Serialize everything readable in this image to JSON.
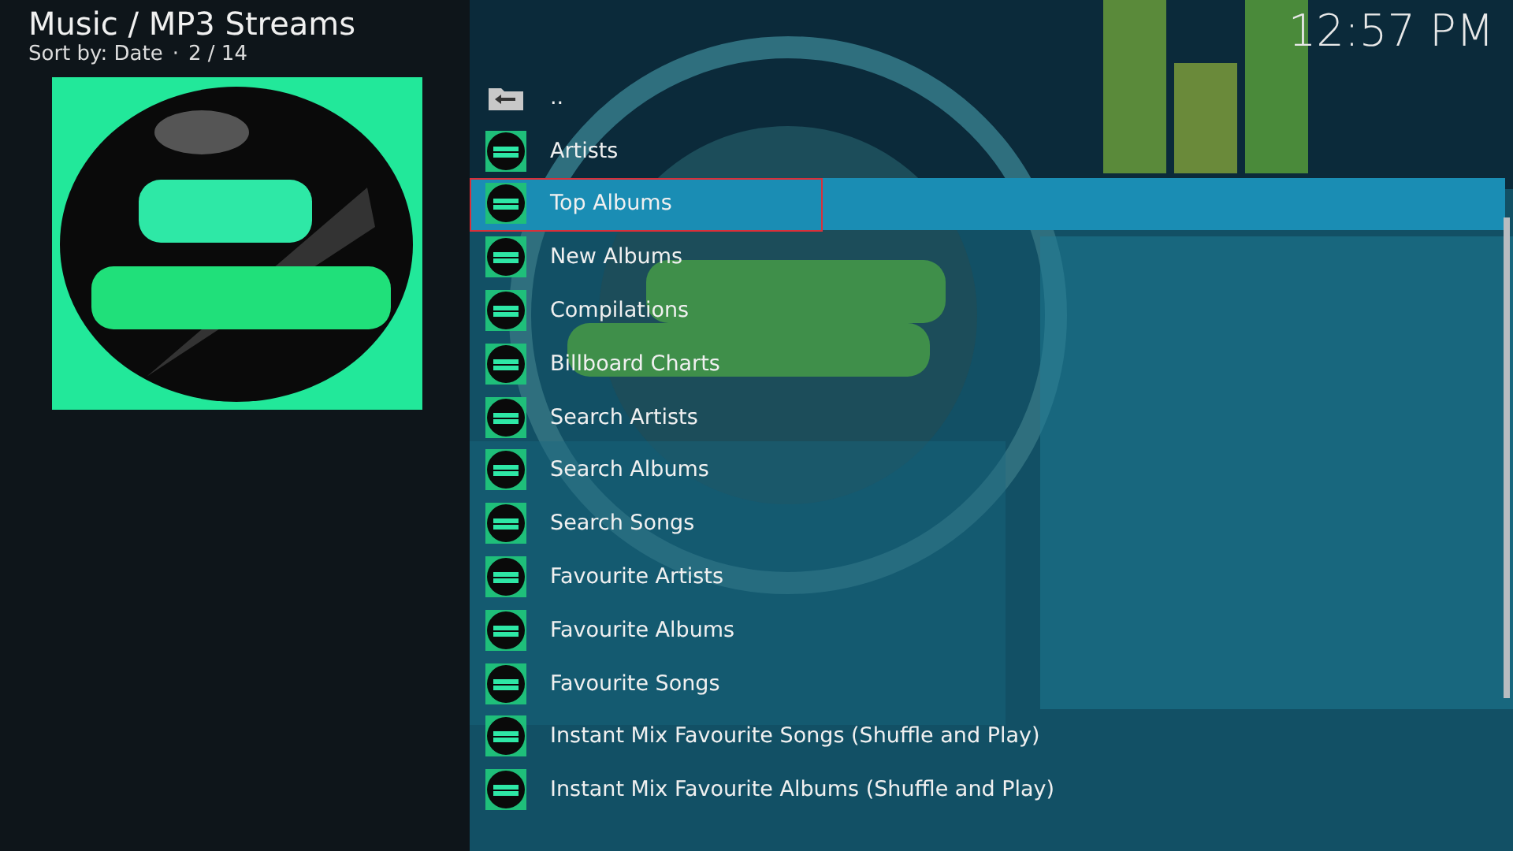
{
  "header": {
    "title": "Music / MP3 Streams",
    "sort": "Sort by: Date",
    "separator": "·",
    "position": "2 / 14"
  },
  "clock": "12:57 PM",
  "items": [
    {
      "label": "..",
      "kind": "parent",
      "selected": false
    },
    {
      "label": "Artists",
      "kind": "entry",
      "selected": false
    },
    {
      "label": "Top Albums",
      "kind": "entry",
      "selected": true
    },
    {
      "label": "New Albums",
      "kind": "entry",
      "selected": false
    },
    {
      "label": "Compilations",
      "kind": "entry",
      "selected": false
    },
    {
      "label": "Billboard Charts",
      "kind": "entry",
      "selected": false
    },
    {
      "label": "Search Artists",
      "kind": "entry",
      "selected": false
    },
    {
      "label": "Search Albums",
      "kind": "entry",
      "selected": false
    },
    {
      "label": "Search Songs",
      "kind": "entry",
      "selected": false
    },
    {
      "label": "Favourite Artists",
      "kind": "entry",
      "selected": false
    },
    {
      "label": "Favourite Albums",
      "kind": "entry",
      "selected": false
    },
    {
      "label": "Favourite Songs",
      "kind": "entry",
      "selected": false
    },
    {
      "label": "Instant Mix Favourite Songs (Shuffle and Play)",
      "kind": "entry",
      "selected": false
    },
    {
      "label": "Instant Mix Favourite Albums (Shuffle and Play)",
      "kind": "entry",
      "selected": false
    }
  ]
}
